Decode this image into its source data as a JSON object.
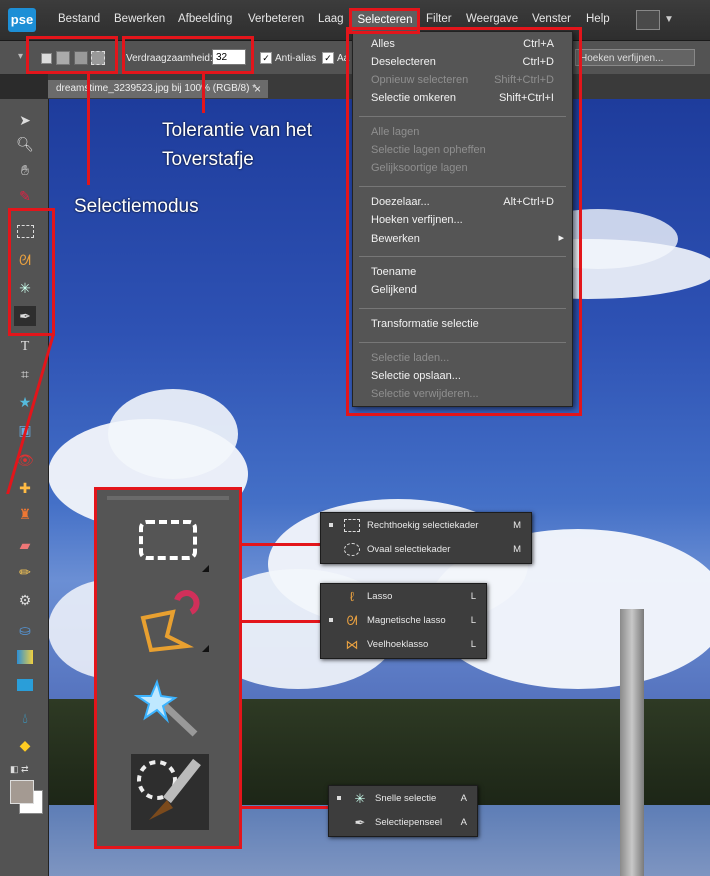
{
  "app": {
    "logo": "pse"
  },
  "menubar": {
    "items": [
      "Bestand",
      "Bewerken",
      "Afbeelding",
      "Verbeteren",
      "Laag",
      "Selecteren",
      "Filter",
      "Weergave",
      "Venster",
      "Help"
    ]
  },
  "options_bar": {
    "tolerance_label": "Verdraagzaamheid:",
    "tolerance_value": "32",
    "anti_alias_label": "Anti-alias",
    "second_check_label": "Aa",
    "refine_label": "Hoeken verfijnen..."
  },
  "document": {
    "tab_title": "dreamstime_3239523.jpg bij 100% (RGB/8) *",
    "close": "×"
  },
  "dropdown": {
    "items": [
      {
        "label": "Alles",
        "shortcut": "Ctrl+A",
        "enabled": true
      },
      {
        "label": "Deselecteren",
        "shortcut": "Ctrl+D",
        "enabled": true
      },
      {
        "label": "Opnieuw selecteren",
        "shortcut": "Shift+Ctrl+D",
        "enabled": false
      },
      {
        "label": "Selectie omkeren",
        "shortcut": "Shift+Ctrl+I",
        "enabled": true
      },
      {
        "label": "Alle lagen",
        "shortcut": "",
        "enabled": false
      },
      {
        "label": "Selectie lagen opheffen",
        "shortcut": "",
        "enabled": false
      },
      {
        "label": "Gelijksoortige lagen",
        "shortcut": "",
        "enabled": false
      },
      {
        "label": "Doezelaar...",
        "shortcut": "Alt+Ctrl+D",
        "enabled": true
      },
      {
        "label": "Hoeken verfijnen...",
        "shortcut": "",
        "enabled": true
      },
      {
        "label": "Bewerken",
        "shortcut": "▸",
        "enabled": true
      },
      {
        "label": "Toename",
        "shortcut": "",
        "enabled": true
      },
      {
        "label": "Gelijkend",
        "shortcut": "",
        "enabled": true
      },
      {
        "label": "Transformatie selectie",
        "shortcut": "",
        "enabled": true
      },
      {
        "label": "Selectie laden...",
        "shortcut": "",
        "enabled": false
      },
      {
        "label": "Selectie opslaan...",
        "shortcut": "",
        "enabled": true
      },
      {
        "label": "Selectie verwijderen...",
        "shortcut": "",
        "enabled": false
      }
    ]
  },
  "annotations": {
    "tolerance_line1": "Tolerantie van het",
    "tolerance_line2": "Toverstafje",
    "selection_mode": "Selectiemodus"
  },
  "flyouts": {
    "marquee": [
      {
        "label": "Rechthoekig selectiekader",
        "key": "M",
        "active": true
      },
      {
        "label": "Ovaal selectiekader",
        "key": "M",
        "active": false
      }
    ],
    "lasso": [
      {
        "label": "Lasso",
        "key": "L",
        "active": false
      },
      {
        "label": "Magnetische lasso",
        "key": "L",
        "active": true
      },
      {
        "label": "Veelhoeklasso",
        "key": "L",
        "active": false
      }
    ],
    "quick": [
      {
        "label": "Snelle selectie",
        "key": "A",
        "active": true
      },
      {
        "label": "Selectiepenseel",
        "key": "A",
        "active": false
      }
    ]
  },
  "colors": {
    "annotation_red": "#e3151b",
    "logo_blue": "#1d8fd6"
  }
}
